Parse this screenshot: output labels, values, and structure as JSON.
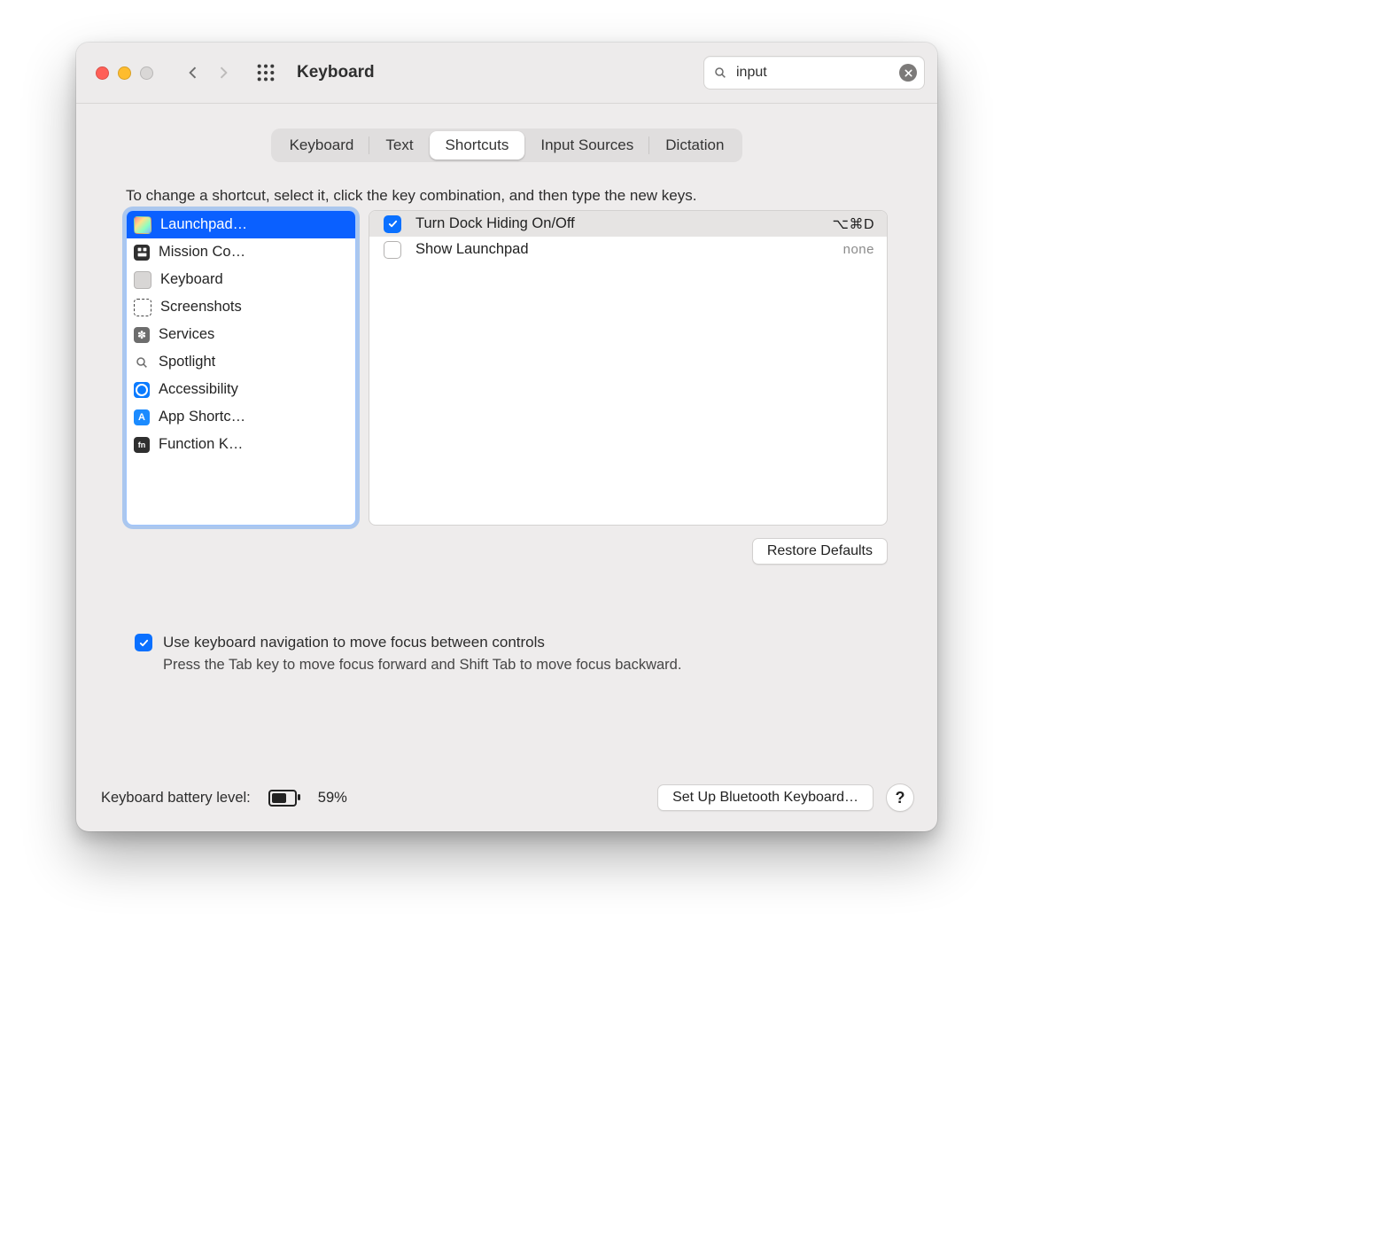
{
  "title": "Keyboard",
  "search": {
    "value": "input"
  },
  "tabs": [
    {
      "label": "Keyboard",
      "active": false
    },
    {
      "label": "Text",
      "active": false
    },
    {
      "label": "Shortcuts",
      "active": true
    },
    {
      "label": "Input Sources",
      "active": false
    },
    {
      "label": "Dictation",
      "active": false
    }
  ],
  "hint": "To change a shortcut, select it, click the key combination, and then type the new keys.",
  "categories": [
    {
      "label": "Launchpad…",
      "icon": "launchpad",
      "selected": true
    },
    {
      "label": "Mission Co…",
      "icon": "mission"
    },
    {
      "label": "Keyboard",
      "icon": "keyboard"
    },
    {
      "label": "Screenshots",
      "icon": "screenshot"
    },
    {
      "label": "Services",
      "icon": "services"
    },
    {
      "label": "Spotlight",
      "icon": "spotlight"
    },
    {
      "label": "Accessibility",
      "icon": "accessibility"
    },
    {
      "label": "App Shortc…",
      "icon": "appstore"
    },
    {
      "label": "Function K…",
      "icon": "fn"
    }
  ],
  "shortcuts": [
    {
      "label": "Turn Dock Hiding On/Off",
      "checked": true,
      "keys": "⌥⌘D",
      "selected": true
    },
    {
      "label": "Show Launchpad",
      "checked": false,
      "keys": "none",
      "none": true
    }
  ],
  "restore": "Restore Defaults",
  "kbnav": {
    "label": "Use keyboard navigation to move focus between controls",
    "sub": "Press the Tab key to move focus forward and Shift Tab to move focus backward.",
    "checked": true
  },
  "battery": {
    "label": "Keyboard battery level:",
    "pct": "59%"
  },
  "bluetooth": "Set Up Bluetooth Keyboard…",
  "help": "?"
}
